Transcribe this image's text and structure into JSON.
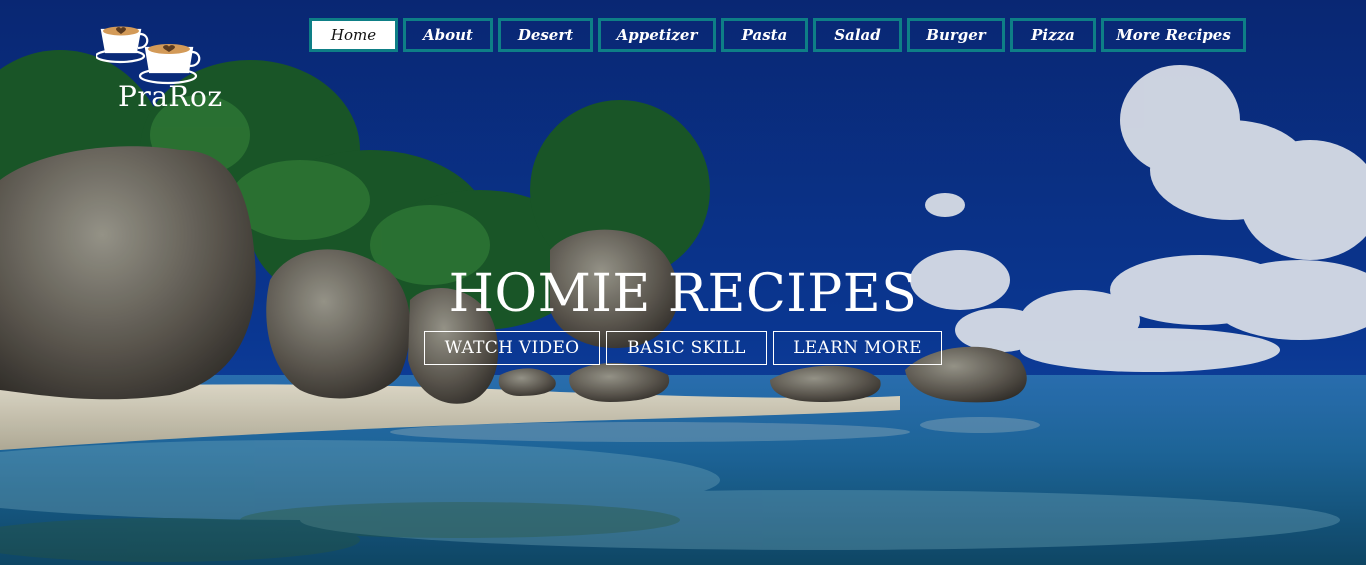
{
  "logo": {
    "brand": "PraRoz",
    "icon": "coffee-cups-icon"
  },
  "nav": {
    "items": [
      {
        "label": "Home",
        "active": true
      },
      {
        "label": "About"
      },
      {
        "label": "Desert"
      },
      {
        "label": "Appetizer"
      },
      {
        "label": "Pasta"
      },
      {
        "label": "Salad"
      },
      {
        "label": "Burger"
      },
      {
        "label": "Pizza"
      },
      {
        "label": "More Recipes"
      }
    ]
  },
  "hero": {
    "title": "HOMIE RECIPES",
    "buttons": [
      {
        "label": "WATCH VIDEO"
      },
      {
        "label": "BASIC SKILL"
      },
      {
        "label": "LEARN MORE"
      }
    ]
  },
  "colors": {
    "nav_border": "#0e7f86",
    "active_bg": "#ffffff",
    "text": "#ffffff"
  }
}
